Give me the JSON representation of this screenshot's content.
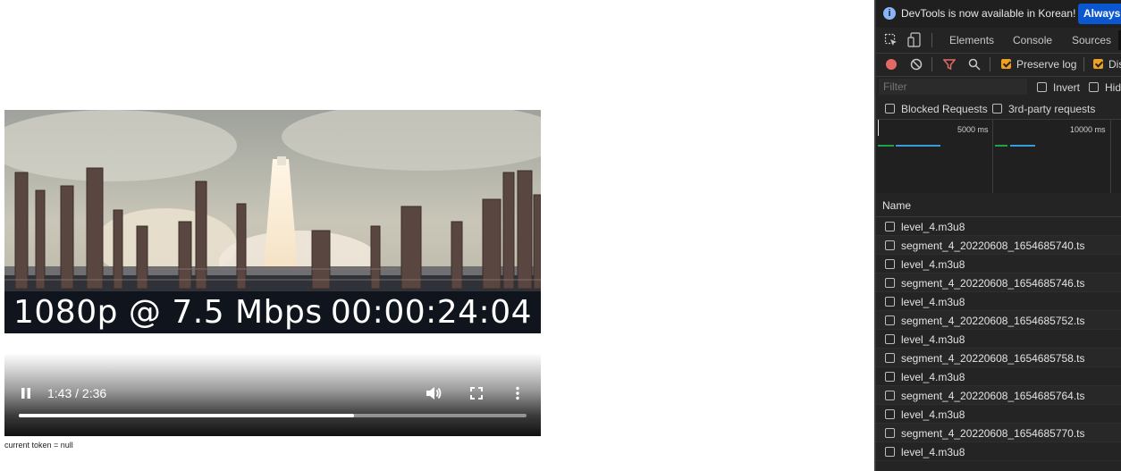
{
  "video": {
    "overlay_resolution": "1080p @ 7.5 Mbps",
    "overlay_timecode": "00:00:24:04"
  },
  "player": {
    "time": "1:43 / 2:36",
    "progress": 0.66,
    "pause_icon": "pause-icon",
    "volume_icon": "volume-icon",
    "fullscreen_icon": "fullscreen-icon",
    "more_icon": "more-vert-icon"
  },
  "token_line": "current token = null",
  "devtools": {
    "info": {
      "message": "DevTools is now available in Korean!",
      "always_button": "Always match Chrome's language"
    },
    "tabs": [
      "Elements",
      "Console",
      "Sources"
    ],
    "toolbar": {
      "preserve_log": "Preserve log",
      "disable_cache": "Disable cache"
    },
    "filter": {
      "placeholder": "Filter",
      "invert": "Invert",
      "hide_data_urls": "Hide data URLs",
      "blocked_requests": "Blocked Requests",
      "third_party": "3rd-party requests"
    },
    "overview": {
      "tick_1": "5000 ms",
      "tick_2": "10000 ms"
    },
    "name_header": "Name",
    "requests": [
      "level_4.m3u8",
      "segment_4_20220608_1654685740.ts",
      "level_4.m3u8",
      "segment_4_20220608_1654685746.ts",
      "level_4.m3u8",
      "segment_4_20220608_1654685752.ts",
      "level_4.m3u8",
      "segment_4_20220608_1654685758.ts",
      "level_4.m3u8",
      "segment_4_20220608_1654685764.ts",
      "level_4.m3u8",
      "segment_4_20220608_1654685770.ts",
      "level_4.m3u8"
    ]
  }
}
